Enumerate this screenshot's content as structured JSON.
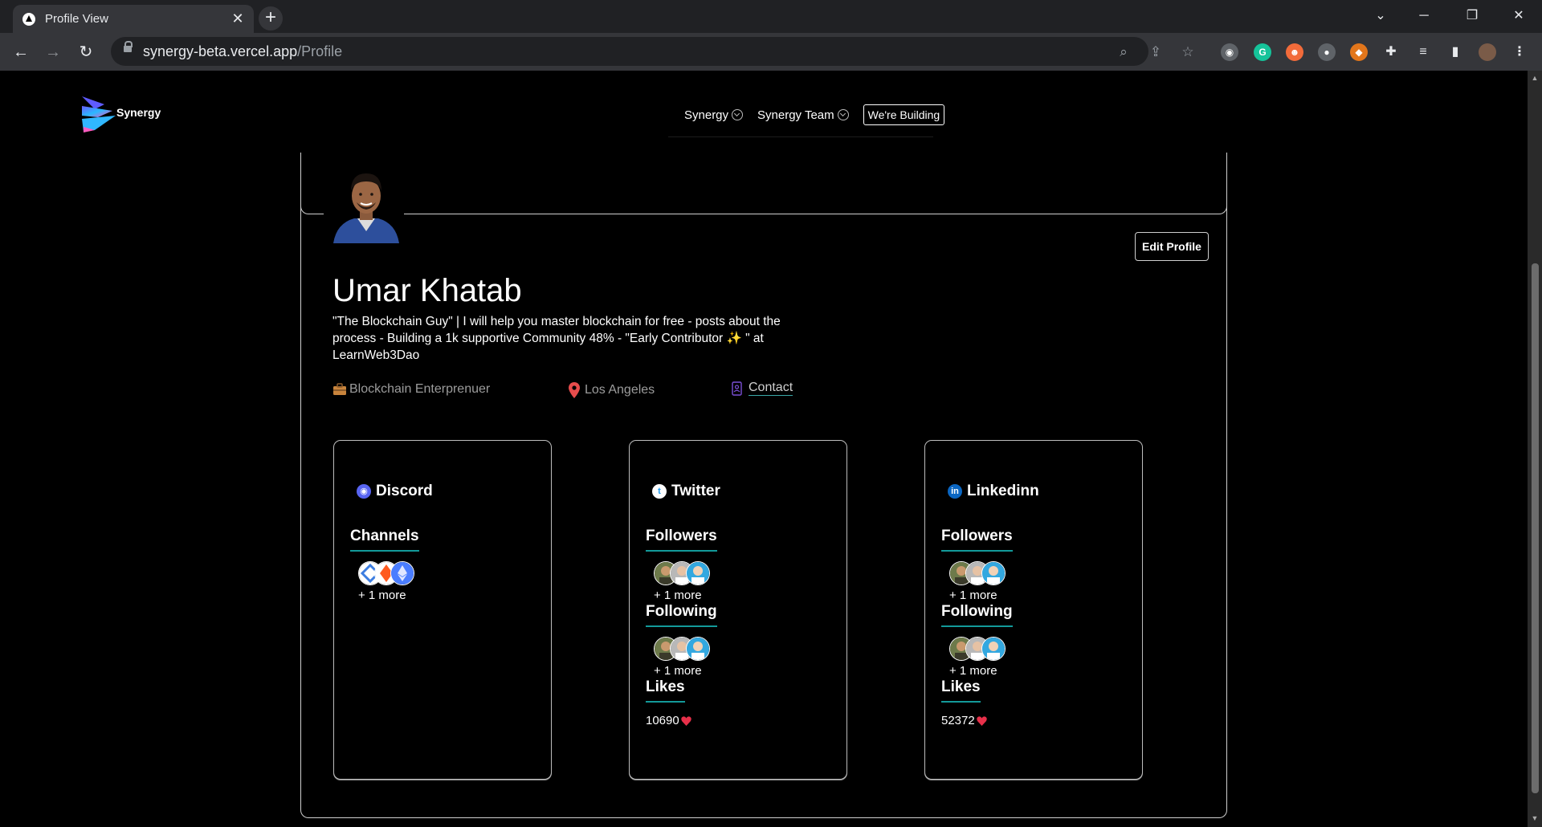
{
  "browser": {
    "tab_title": "Profile View",
    "tab_close": "✕",
    "new_tab": "+",
    "url_host": "synergy-beta.vercel.app",
    "url_path": "/Profile"
  },
  "site": {
    "logo_text": "Synergy",
    "nav": {
      "synergy": "Synergy",
      "team": "Synergy Team",
      "building": "We're Building"
    }
  },
  "profile": {
    "name": "Umar Khatab",
    "bio": "\"The Blockchain Guy\" | I will help you master blockchain for free - posts about the process - Building a 1k supportive Community 48% - \"Early Contributor ✨ \" at LearnWeb3Dao",
    "occupation": "Blockchain Enterprenuer",
    "location": "Los Angeles",
    "contact": "Contact",
    "edit_label": "Edit Profile"
  },
  "cards": {
    "discord": {
      "title": "Discord",
      "channels_label": "Channels",
      "channels_more": "+ 1 more"
    },
    "twitter": {
      "title": "Twitter",
      "followers_label": "Followers",
      "followers_more": "+ 1 more",
      "following_label": "Following",
      "following_more": "+ 1 more",
      "likes_label": "Likes",
      "likes_value": "10690"
    },
    "linkedin": {
      "title": "Linkedinn",
      "followers_label": "Followers",
      "followers_more": "+ 1 more",
      "following_label": "Following",
      "following_more": "+ 1 more",
      "likes_label": "Likes",
      "likes_value": "52372"
    }
  },
  "colors": {
    "accent_underline": "#139a9a",
    "discord": "#5865f2",
    "twitter": "#1d9bf0",
    "linkedin": "#0a66c2",
    "location_pin": "#e74c4c",
    "contact_icon": "#7b4fd6"
  }
}
